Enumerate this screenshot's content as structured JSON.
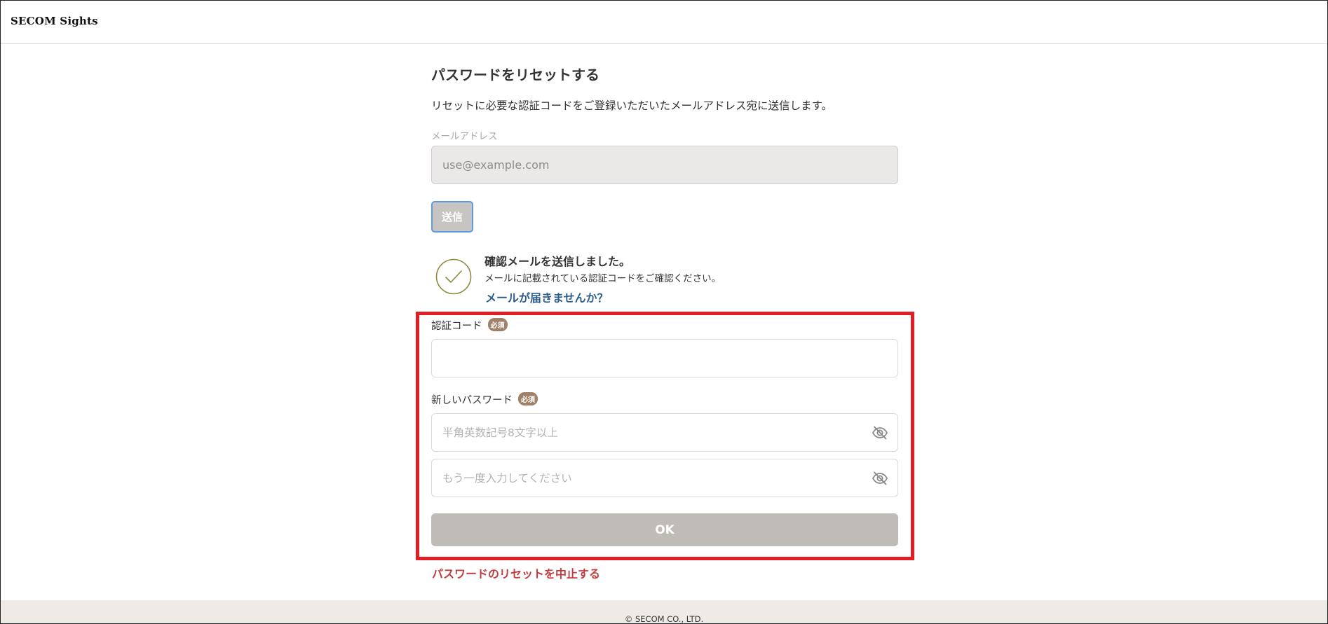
{
  "header": {
    "logo": "SECOM Sights"
  },
  "reset": {
    "title": "パスワードをリセットする",
    "description": "リセットに必要な認証コードをご登録いただいたメールアドレス宛に送信します。",
    "email_label": "メールアドレス",
    "email_placeholder": "use@example.com",
    "send_label": "送信"
  },
  "confirmation": {
    "title": "確認メールを送信しました。",
    "subtitle": "メールに記載されている認証コードをご確認ください。",
    "no_mail_link": "メールが届きませんか？"
  },
  "form": {
    "code_label": "認証コード",
    "required_badge": "必須",
    "password_label": "新しいパスワード",
    "password_placeholder": "半角英数記号8文字以上",
    "confirm_placeholder": "もう一度入力してください",
    "ok_label": "OK"
  },
  "cancel_link": "パスワードのリセットを中止する",
  "footer": {
    "copyright": "© SECOM CO., LTD."
  },
  "colors": {
    "highlight_border": "#e21d24",
    "link_blue": "#2d5f8e",
    "cancel_red": "#c33b3e",
    "badge": "#a08068",
    "disabled_button": "#bfbbb7"
  }
}
